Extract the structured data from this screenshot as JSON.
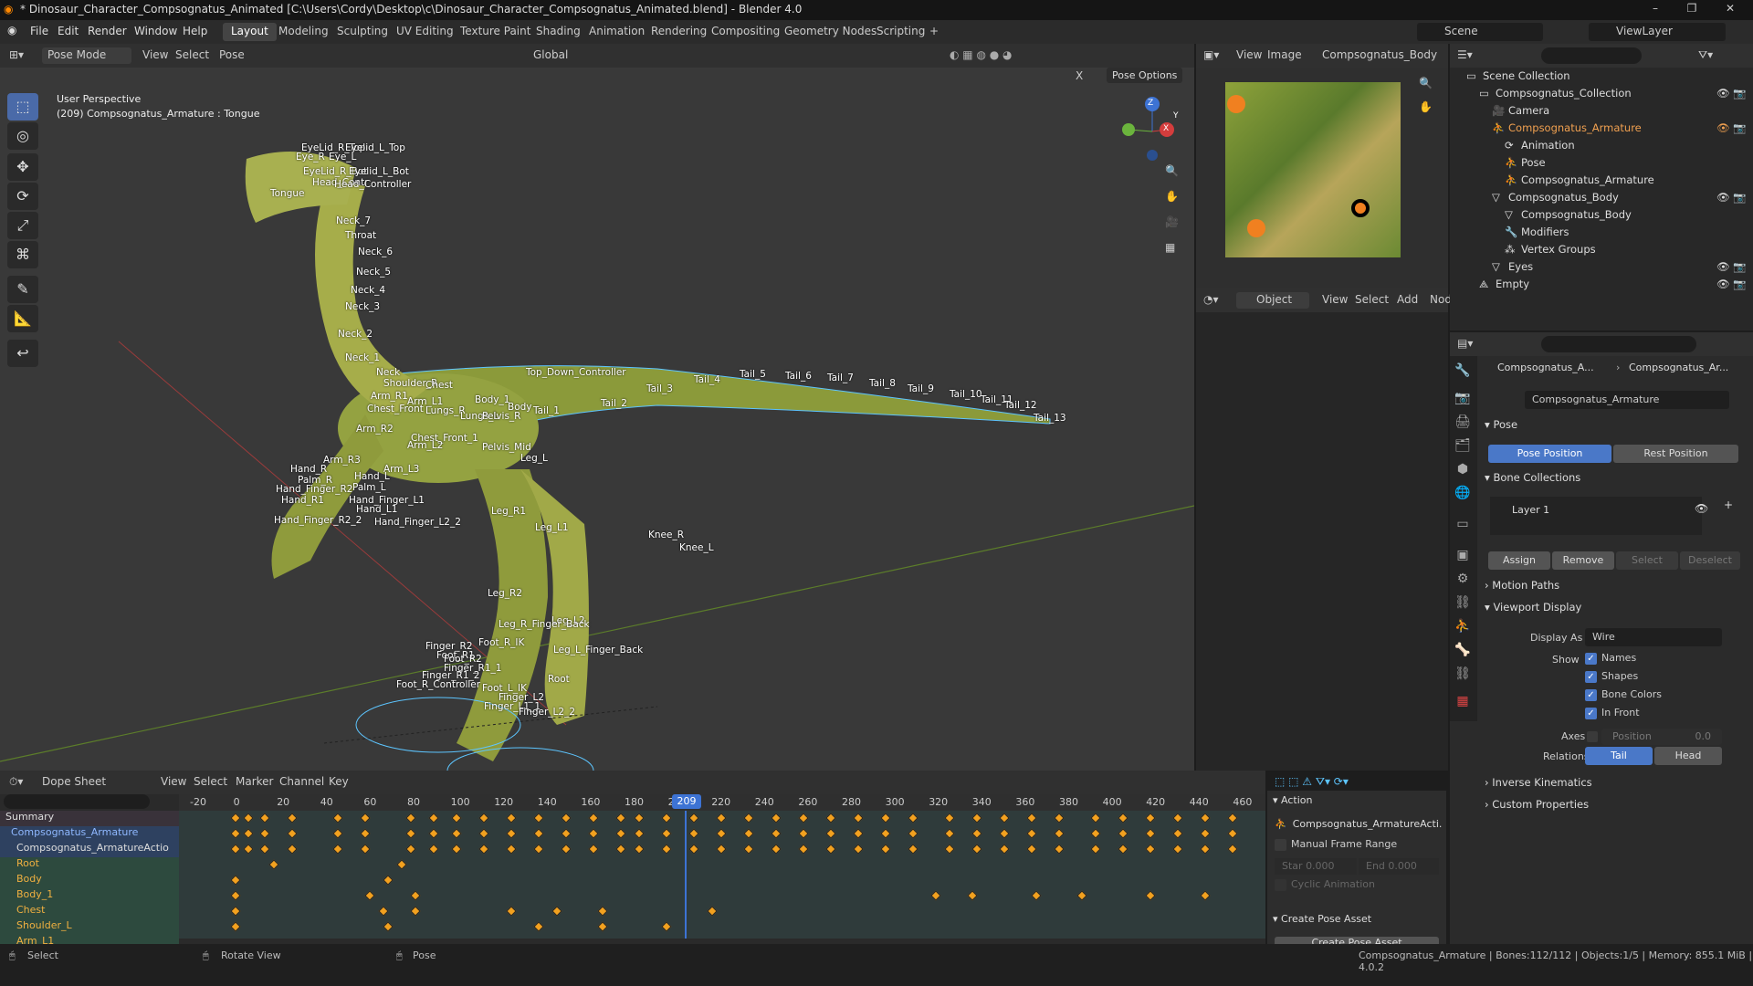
{
  "window": {
    "title": "* Dinosaur_Character_Compsognatus_Animated [C:\\Users\\Cordy\\Desktop\\c\\Dinosaur_Character_Compsognatus_Animated.blend] - Blender 4.0",
    "minimize": "–",
    "maximize": "❐",
    "close": "✕"
  },
  "menu": [
    "File",
    "Edit",
    "Render",
    "Window",
    "Help"
  ],
  "workspaces": [
    "Layout",
    "Modeling",
    "Sculpting",
    "UV Editing",
    "Texture Paint",
    "Shading",
    "Animation",
    "Rendering",
    "Compositing",
    "Geometry Nodes",
    "Scripting",
    "+"
  ],
  "scene": {
    "label": "Scene",
    "view_layer": "ViewLayer"
  },
  "viewport": {
    "mode": "Pose Mode",
    "menus": [
      "View",
      "Select",
      "Pose"
    ],
    "orientation": "Global",
    "pose_options": "Pose Options",
    "perspective": "User Perspective",
    "active": "(209) Compsognatus_Armature : Tongue",
    "x_label": "X",
    "gizmo": {
      "x": "X",
      "y": "Y",
      "z": "Z"
    },
    "tools": [
      "⬚",
      "◎",
      "✥",
      "⟳",
      "⤢",
      "⌘",
      "✎",
      "📐",
      "↩"
    ],
    "nav": [
      "🔍",
      "✋",
      "🎥",
      "▦"
    ]
  },
  "bones": [
    {
      "t": "EyeLid_R_Top"
    },
    {
      "t": "Eyelid_L_Top"
    },
    {
      "t": "Eye_R"
    },
    {
      "t": "Eye_L"
    },
    {
      "t": "EyeLid_R_Bot"
    },
    {
      "t": "Eyelid_L_Bot"
    },
    {
      "t": "Head_Contr"
    },
    {
      "t": "Head_Controller"
    },
    {
      "t": "Tongue"
    },
    {
      "t": "Neck_7"
    },
    {
      "t": "Throat"
    },
    {
      "t": "Neck_6"
    },
    {
      "t": "Neck_5"
    },
    {
      "t": "Neck_4"
    },
    {
      "t": "Neck_3"
    },
    {
      "t": "Neck_2"
    },
    {
      "t": "Neck_1"
    },
    {
      "t": "Neck"
    },
    {
      "t": "Top_Down_Controller"
    },
    {
      "t": "Shoulder_R"
    },
    {
      "t": "Chest"
    },
    {
      "t": "Arm_R1"
    },
    {
      "t": "Arm_L1"
    },
    {
      "t": "Body_1"
    },
    {
      "t": "Body"
    },
    {
      "t": "Tail_1"
    },
    {
      "t": "Tail_2"
    },
    {
      "t": "Tail_3"
    },
    {
      "t": "Tail_4"
    },
    {
      "t": "Tail_5"
    },
    {
      "t": "Tail_6"
    },
    {
      "t": "Tail_7"
    },
    {
      "t": "Tail_8"
    },
    {
      "t": "Tail_9"
    },
    {
      "t": "Tail_10"
    },
    {
      "t": "Tail_11"
    },
    {
      "t": "Tail_12"
    },
    {
      "t": "Tail_13"
    },
    {
      "t": "Chest_Front"
    },
    {
      "t": "Lungs_R"
    },
    {
      "t": "Lungs_L"
    },
    {
      "t": "Pelvis_R"
    },
    {
      "t": "Arm_R2"
    },
    {
      "t": "Chest_Front_1"
    },
    {
      "t": "Arm_L2"
    },
    {
      "t": "Pelvis_Mid"
    },
    {
      "t": "Leg_L"
    },
    {
      "t": "Arm_R3"
    },
    {
      "t": "Arm_L3"
    },
    {
      "t": "Hand_R"
    },
    {
      "t": "Palm_R"
    },
    {
      "t": "Hand_L"
    },
    {
      "t": "Palm_L"
    },
    {
      "t": "Hand_Finger_R2"
    },
    {
      "t": "Hand_R1"
    },
    {
      "t": "Hand_Finger_L1"
    },
    {
      "t": "Hand_L1"
    },
    {
      "t": "Hand_Finger_R2_2"
    },
    {
      "t": "Hand_Finger_L2_2"
    },
    {
      "t": "Leg_R1"
    },
    {
      "t": "Leg_L1"
    },
    {
      "t": "Knee_R"
    },
    {
      "t": "Knee_L"
    },
    {
      "t": "Leg_R2"
    },
    {
      "t": "Leg_L2"
    },
    {
      "t": "Leg_R_Finger_Back"
    },
    {
      "t": "Leg_L_Finger_Back"
    },
    {
      "t": "Foot_R_IK"
    },
    {
      "t": "Finger_R2"
    },
    {
      "t": "Foot_R1"
    },
    {
      "t": "Foot_R2"
    },
    {
      "t": "Finger_R1_1"
    },
    {
      "t": "Finger_R1_2"
    },
    {
      "t": "Foot_R_Controller"
    },
    {
      "t": "Root"
    },
    {
      "t": "Foot_L_IK"
    },
    {
      "t": "Finger_L2"
    },
    {
      "t": "Finger_L1_1"
    },
    {
      "t": "Finger_L2_2"
    },
    {
      "t": "Foot_Controller"
    }
  ],
  "image_editor": {
    "menus": [
      "View",
      "Image"
    ],
    "image": "Compsognatus_Body"
  },
  "node_editor": {
    "mode": "Object",
    "menus": [
      "View",
      "Select",
      "Add",
      "Nod"
    ]
  },
  "outliner": {
    "rows": [
      {
        "label": "Scene Collection"
      },
      {
        "label": "Compsognatus_Collection"
      },
      {
        "label": "Camera"
      },
      {
        "label": "Compsognatus_Armature"
      },
      {
        "label": "Animation"
      },
      {
        "label": "Pose"
      },
      {
        "label": "Compsognatus_Armature"
      },
      {
        "label": "Compsognatus_Body"
      },
      {
        "label": "Compsognatus_Body"
      },
      {
        "label": "Modifiers"
      },
      {
        "label": "Vertex Groups"
      },
      {
        "label": "Eyes"
      },
      {
        "label": "Empty"
      }
    ]
  },
  "properties": {
    "breadcrumb": [
      "Compsognatus_A...",
      "Compsognatus_Ar..."
    ],
    "data_name": "Compsognatus_Armature",
    "pose_section": "Pose",
    "pose_position": "Pose Position",
    "rest_position": "Rest Position",
    "bone_collections": "Bone Collections",
    "layer": "Layer 1",
    "assign": "Assign",
    "remove": "Remove",
    "select": "Select",
    "deselect": "Deselect",
    "motion_paths": "Motion Paths",
    "viewport_display": "Viewport Display",
    "display_as_label": "Display As",
    "display_as": "Wire",
    "show_label": "Show",
    "names": "Names",
    "shapes": "Shapes",
    "bone_colors": "Bone Colors",
    "in_front": "In Front",
    "axes": "Axes",
    "position": "Position",
    "position_val": "0.0",
    "relations": "Relations",
    "tail": "Tail",
    "head": "Head",
    "inverse_kinematics": "Inverse Kinematics",
    "custom_properties": "Custom Properties"
  },
  "dope": {
    "mode": "Dope Sheet",
    "menus": [
      "View",
      "Select",
      "Marker",
      "Channel",
      "Key"
    ],
    "frames": [
      "-20",
      "0",
      "20",
      "40",
      "60",
      "80",
      "100",
      "120",
      "140",
      "160",
      "180",
      "200",
      "220",
      "240",
      "260",
      "280",
      "300",
      "320",
      "340",
      "360",
      "380",
      "400",
      "420",
      "440",
      "460"
    ],
    "current": "209",
    "channels": [
      {
        "label": "Summary"
      },
      {
        "label": "Compsognatus_Armature"
      },
      {
        "label": "Compsognatus_ArmatureActio"
      },
      {
        "label": "Root"
      },
      {
        "label": "Body"
      },
      {
        "label": "Body_1"
      },
      {
        "label": "Chest"
      },
      {
        "label": "Shoulder_L"
      },
      {
        "label": "Arm_L1"
      }
    ]
  },
  "action_panel": {
    "title": "Action",
    "name": "Compsognatus_ArmatureActi...",
    "manual_range": "Manual Frame Range",
    "start": "Star",
    "start_val": "0.000",
    "end": "End",
    "end_val": "0.000",
    "cyclic": "Cyclic Animation",
    "create_pose": "Create Pose Asset",
    "create_btn": "Create Pose Asset"
  },
  "status": {
    "select": "Select",
    "rotate": "Rotate View",
    "pose": "Pose",
    "info": "Compsognatus_Armature | Bones:112/112 | Objects:1/5 | Memory: 855.1 MiB | 4.0.2"
  },
  "colors": {
    "accent": "#4a78c8",
    "keyframe": "#f2a11f",
    "playhead": "#3d73d4",
    "wire": "#5dc5ff"
  }
}
